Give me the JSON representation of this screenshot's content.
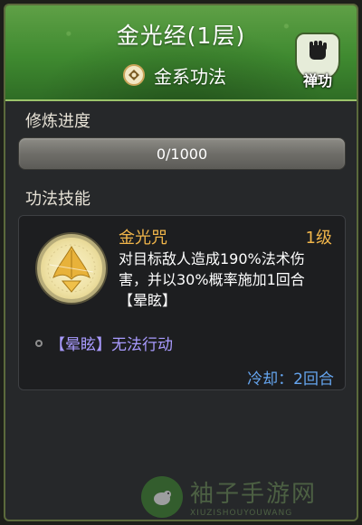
{
  "header": {
    "title": "金光经(1层)",
    "element_label": "金系功法",
    "element_icon": "metal-element-icon",
    "badge_label": "禅功",
    "badge_icon": "fist-icon"
  },
  "progress": {
    "label": "修炼进度",
    "text": "0/1000",
    "current": 0,
    "max": 1000
  },
  "skills": {
    "label": "功法技能",
    "items": [
      {
        "name": "金光咒",
        "level": "1级",
        "description": "对目标敌人造成190%法术伤害，并以30%概率施加1回合【晕眩】",
        "effect": "【晕眩】无法行动",
        "cooldown": "冷却：2回合",
        "icon": "golden-light-skill-icon"
      }
    ]
  },
  "watermark": {
    "cn": "袖子手游网",
    "en": "XIUZISHOUYOUWANG"
  },
  "colors": {
    "header_green": "#3f8a30",
    "skill_gold": "#f0b54a",
    "effect_purple": "#a99bff",
    "cooldown_blue": "#65a5ef"
  }
}
